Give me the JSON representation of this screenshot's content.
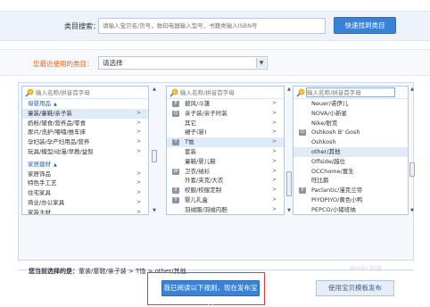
{
  "search": {
    "label": "类目搜索：",
    "placeholder": "请输入宝贝名/货号，数码电器输入型号，书籍类输入ISBN号",
    "button_label": "快速找到类目"
  },
  "recent": {
    "label": "您最近使用的类目：",
    "selected": "请选择"
  },
  "columns": [
    {
      "placeholder": "输入名称/拼音首字母",
      "items": [
        {
          "label": "母婴用品",
          "group": true
        },
        {
          "label": "童装/童鞋/亲子装",
          "arrow": ">",
          "selected": true
        },
        {
          "label": "奶粉/辅食/营养品/零食",
          "arrow": ">"
        },
        {
          "label": "尿片/洗护/喂哺/推车床",
          "arrow": ">"
        },
        {
          "label": "孕妇装/孕产妇用品/营养",
          "arrow": ">"
        },
        {
          "label": "玩具/模型/动漫/早教/益智",
          "arrow": ">"
        },
        {
          "label": "家居建材",
          "group": true
        },
        {
          "label": "家居饰品",
          "arrow": ">"
        },
        {
          "label": "特色手工艺",
          "arrow": ">"
        },
        {
          "label": "住宅家具",
          "arrow": ">"
        },
        {
          "label": "商业/办公家具",
          "arrow": ">"
        },
        {
          "label": "家装主材",
          "arrow": ">"
        }
      ]
    },
    {
      "placeholder": "输入名称/拼音首字母",
      "items": [
        {
          "label": "披风/斗篷",
          "arrow": ">",
          "badge": "P"
        },
        {
          "label": "亲子装/亲子时装",
          "arrow": ">",
          "badge": "Q"
        },
        {
          "label": "其它",
          "arrow": ">"
        },
        {
          "label": "裙子(新)",
          "arrow": ">"
        },
        {
          "label": "T恤",
          "arrow": ">",
          "badge": "T",
          "selected": true
        },
        {
          "label": "套装",
          "arrow": ">"
        },
        {
          "label": "童鞋/婴儿鞋",
          "arrow": ">"
        },
        {
          "label": "卫衣/绒衫",
          "arrow": ">",
          "badge": "W"
        },
        {
          "label": "外套/夹克/大衣",
          "arrow": ">"
        },
        {
          "label": "校服/校服定制",
          "arrow": ">",
          "badge": "X"
        },
        {
          "label": "婴儿礼盒",
          "arrow": ">",
          "badge": "Y"
        },
        {
          "label": "羽绒服/羽绒内胆",
          "arrow": ">"
        }
      ]
    },
    {
      "placeholder": "输入名称/拼音首字母",
      "items": [
        {
          "label": "Neuer/诺伊儿"
        },
        {
          "label": "NOVA/小新星"
        },
        {
          "label": "Nike/耐克"
        },
        {
          "label": "Oshkosh B' Gosh",
          "badge": "O"
        },
        {
          "label": "Oshkosh"
        },
        {
          "label": "other/其他",
          "selected": true
        },
        {
          "label": "Offside/越位"
        },
        {
          "label": "OCChome/富生"
        },
        {
          "label": "旺比鹅"
        },
        {
          "label": "Paclantic/漫克兰帝",
          "badge": "P"
        },
        {
          "label": "PIYOPIYO/黄色小鸭"
        },
        {
          "label": "PEPCO/小猪班纳"
        }
      ]
    }
  ],
  "path": {
    "prefix": "您当前选择的是：",
    "value": "童装/童鞋/亲子装 > T恤 > other/其他"
  },
  "publish_label": "我已阅读以下规则，现在发布宝贝",
  "rules_label": "使用宝贝模板发布",
  "watermark": "Baidu 知道",
  "colors": {
    "accent": "#3a82d6",
    "highlight": "#e1ebf8",
    "orange_label": "#e0641c",
    "focus_border": "#e23b3b"
  }
}
